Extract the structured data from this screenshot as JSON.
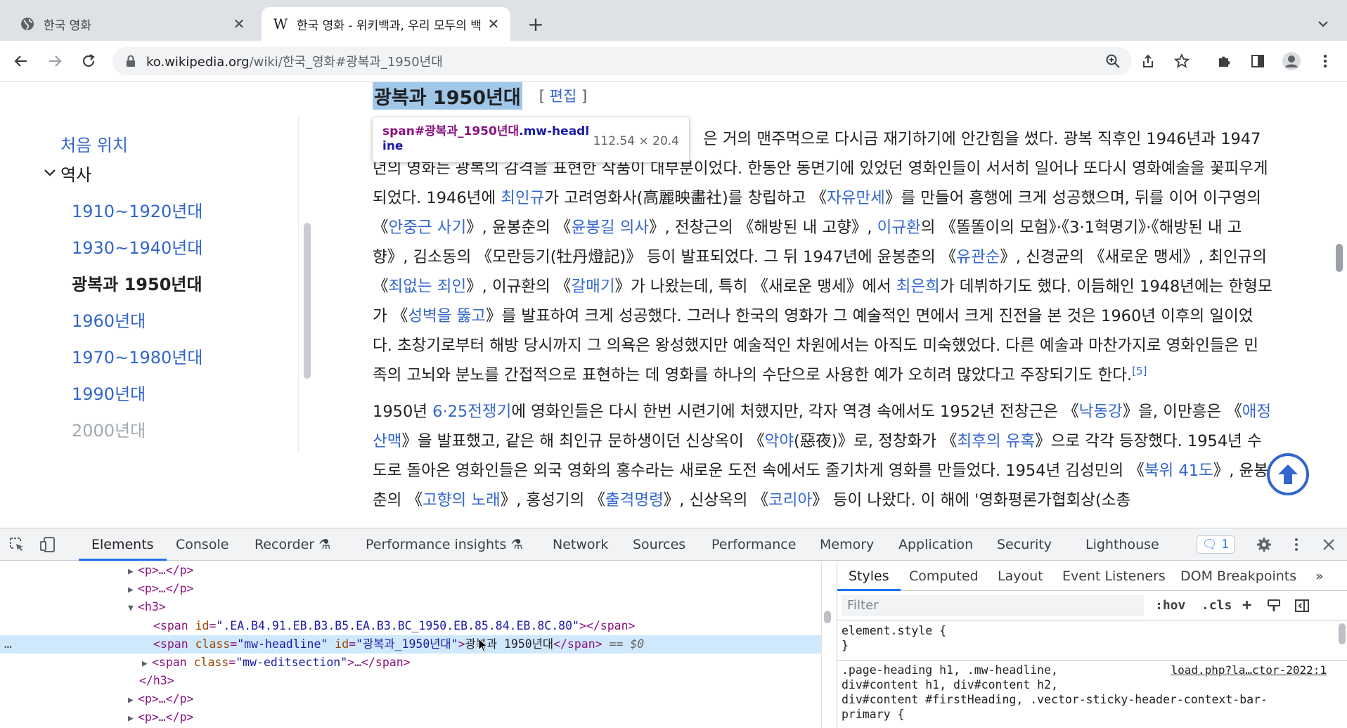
{
  "browser": {
    "tabs": [
      {
        "title": "한국 영화",
        "active": false
      },
      {
        "title": "한국 영화 - 위키백과, 우리 모두의 백",
        "active": true
      }
    ],
    "new_tab": "+",
    "url_host": "ko.wikipedia.org",
    "url_path": "/wiki/한국_영화#광복과_1950년대"
  },
  "toc": {
    "top": "처음 위치",
    "section": "역사",
    "items": [
      {
        "label": "1910~1920년대",
        "state": "link"
      },
      {
        "label": "1930~1940년대",
        "state": "link"
      },
      {
        "label": "광복과 1950년대",
        "state": "current"
      },
      {
        "label": "1960년대",
        "state": "link"
      },
      {
        "label": "1970~1980년대",
        "state": "link"
      },
      {
        "label": "1990년대",
        "state": "link"
      },
      {
        "label": "2000년대",
        "state": "faded"
      }
    ]
  },
  "heading": {
    "title": "광복과 1950년대",
    "edit_open": "[ ",
    "edit_label": "편집",
    "edit_close": " ]"
  },
  "tooltip": {
    "tag": "span#광복과_1950년대",
    "cls": ".mw-headl",
    "cls2": "ine",
    "size": "112.54 × 20.4"
  },
  "article": {
    "p1": [
      {
        "t": "은 거의 맨주먹으로 다시금 재기하기에 안간힘을 썼다. 광복 직후인 1946년과 1947"
      },
      {
        "br": true
      },
      {
        "t": "년의 영화는 광복의 감격을 표현한 작품이 대부분이었다. 한동안 동면기에 있었던 영화인들이 서서히 일어나 또다시 영화예술을 꽃피우게 되었다. 1946년에 "
      },
      {
        "a": "최인규"
      },
      {
        "t": "가 고려영화사(高麗映畵社)를 창립하고 《"
      },
      {
        "a": "자유만세"
      },
      {
        "t": "》를 만들어 흥행에 크게 성공했으며, 뒤를 이어 이구영의 《"
      },
      {
        "a": "안중근 사기"
      },
      {
        "t": "》, 윤봉춘의 《"
      },
      {
        "a": "윤봉길 의사"
      },
      {
        "t": "》, 전창근의 《해방된 내 고향》, "
      },
      {
        "a": "이규환"
      },
      {
        "t": "의 《똘똘이의 모험》·《3·1혁명기》·《해방된 내 고향》, 김소동의 《모란등기(牡丹燈記)》 등이 발표되었다. 그 뒤 1947년에 윤봉춘의 《"
      },
      {
        "a": "유관순"
      },
      {
        "t": "》, 신경균의 《새로운 맹세》, 최인규의 《"
      },
      {
        "a": "죄없는 죄인"
      },
      {
        "t": "》, 이규환의 《"
      },
      {
        "a": "갈매기"
      },
      {
        "t": "》가 나왔는데, 특히 《새로운 맹세》에서 "
      },
      {
        "a": "최은희"
      },
      {
        "t": "가 데뷔하기도 했다. 이듬해인 1948년에는 한형모가 《"
      },
      {
        "a": "성벽을 뚫고"
      },
      {
        "t": "》를 발표하여 크게 성공했다. 그러나 한국의 영화가 그 예술적인 면에서 크게 진전을 본 것은 1960년 이후의 일이었다. 초창기로부터 해방 당시까지 그 의욕은 왕성했지만 예술적인 차원에서는 아직도 미숙했었다. 다른 예술과 마찬가지로 영화인들은 민족의 고뇌와 분노를 간접적으로 표현하는 데 영화를 하나의 수단으로 사용한 예가 오히려 많았다고 주장되기도 한다."
      },
      {
        "sup": "[5]"
      }
    ],
    "p2": [
      {
        "t": "1950년 "
      },
      {
        "a": "6·25전쟁기"
      },
      {
        "t": "에 영화인들은 다시 한번 시련기에 처했지만, 각자 역경 속에서도 1952년 전창근은 《"
      },
      {
        "a": "낙동강"
      },
      {
        "t": "》을, 이만흥은 《"
      },
      {
        "a": "애정산맥"
      },
      {
        "t": "》을 발표했고, 같은 해 최인규 문하생이던 신상옥이 《"
      },
      {
        "a": "악야"
      },
      {
        "t": "(惡夜)》로, 정창화가 《"
      },
      {
        "a": "최후의 유혹"
      },
      {
        "t": "》으로 각각 등장했다. 1954년 수도로 돌아온 영화인들은 외국 영화의 홍수라는 새로운 도전 속에서도 줄기차게 영화를 만들었다. 1954년 김성민의 《"
      },
      {
        "a": "북위 41도"
      },
      {
        "t": "》, 윤봉춘의 《"
      },
      {
        "a": "고향의 노래"
      },
      {
        "t": "》, 홍성기의 《"
      },
      {
        "a": "출격명령"
      },
      {
        "t": "》, 신상옥의 《"
      },
      {
        "a": "코리아"
      },
      {
        "t": "》 등이 나왔다. 이 해에 '영화평론가협회상(소총"
      }
    ]
  },
  "devtools": {
    "tabs": [
      "Elements",
      "Console",
      "Recorder",
      "Performance insights",
      "Network",
      "Sources",
      "Performance",
      "Memory",
      "Application",
      "Security",
      "Lighthouse"
    ],
    "issues_count": "1",
    "dom": {
      "p": "<p>…</p>",
      "h3_open": "<h3>",
      "span1_open": "<span ",
      "span1_attr": "id",
      "span1_val": "\".EA.B4.91.EB.B3.B5.EA.B3.BC_1950.EB.85.84.EB.8C.80\"",
      "span1_close": "></span>",
      "span2_open": "<span ",
      "span2_attr_class": "class",
      "span2_val_class": "\"mw-headline\"",
      "span2_attr_id": "id",
      "span2_val_id": "\"광복과_1950년대\"",
      "span2_gt": ">",
      "span2_text": "광복과 1950년대",
      "span2_close": "</span>",
      "span2_eq": " == $0",
      "span3_open": "<span ",
      "span3_attr": "class",
      "span3_val": "\"mw-editsection\"",
      "span3_rest": ">…</span>",
      "h3_close": "</h3>",
      "dots": "…"
    },
    "styles_tabs": [
      "Styles",
      "Computed",
      "Layout",
      "Event Listeners",
      "DOM Breakpoints"
    ],
    "filter_placeholder": "Filter",
    "hov": ":hov",
    "cls": ".cls",
    "plus": "+",
    "rule1_selector": "element.style {",
    "rule1_close": "}",
    "rule2_lines": [
      ".page-heading h1, .mw-headline,",
      "div#content h1, div#content h2,",
      "div#content #firstHeading, .vector-sticky-header-context-bar-",
      "primary {"
    ],
    "rule2_source": "load.php?la…ctor-2022:1"
  }
}
